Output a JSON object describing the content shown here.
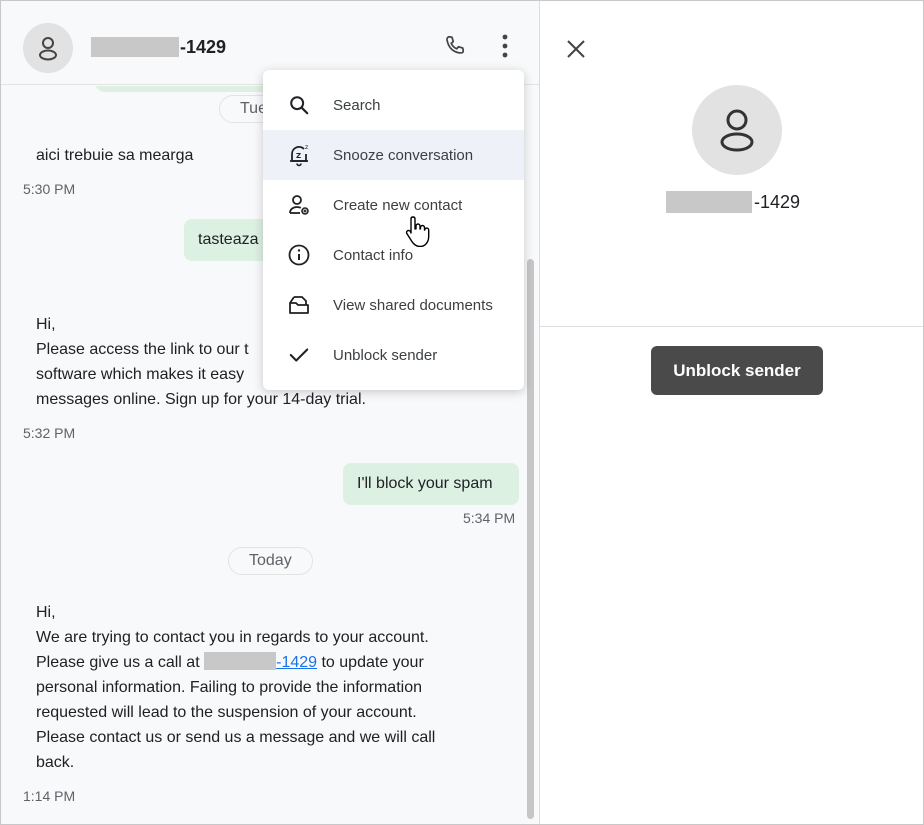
{
  "header": {
    "contact_suffix": "-1429"
  },
  "messages": [
    {
      "type": "received",
      "text": "aici trebuie sa mearga",
      "time": "5:30 PM"
    },
    {
      "type": "sent",
      "text": "tasteaza",
      "time": ""
    },
    {
      "type": "received",
      "lines": [
        "Hi,",
        "Please access the link to our t",
        "software which makes it easy",
        "messages online. Sign up for your 14-day trial."
      ],
      "time": "5:32 PM"
    },
    {
      "type": "sent",
      "text": "I'll block your spam",
      "time": "5:34 PM"
    },
    {
      "type": "received",
      "lines": [
        "Hi,",
        "We are trying to contact you in regards to your account.",
        "Please give us a call at",
        "to update your",
        "personal information. Failing to provide the information",
        "requested will lead to the suspension of your account.",
        "Please contact us or send us a message and we will call",
        "back."
      ],
      "link_suffix": "-1429",
      "time": "1:14 PM"
    }
  ],
  "day_chips": {
    "tue": "Tue",
    "today": "Today"
  },
  "menu": {
    "items": [
      {
        "label": "Search",
        "icon": "search-icon"
      },
      {
        "label": "Snooze conversation",
        "icon": "snooze-bell-icon"
      },
      {
        "label": "Create new contact",
        "icon": "add-contact-icon"
      },
      {
        "label": "Contact info",
        "icon": "info-icon"
      },
      {
        "label": "View shared documents",
        "icon": "shared-documents-icon"
      },
      {
        "label": "Unblock sender",
        "icon": "check-icon"
      }
    ]
  },
  "details": {
    "contact_suffix": "-1429",
    "unblock_label": "Unblock sender"
  },
  "colors": {
    "sent_bubble": "#ddf1e3",
    "unblock_button": "#4a4a4a",
    "link": "#1a73e8"
  }
}
